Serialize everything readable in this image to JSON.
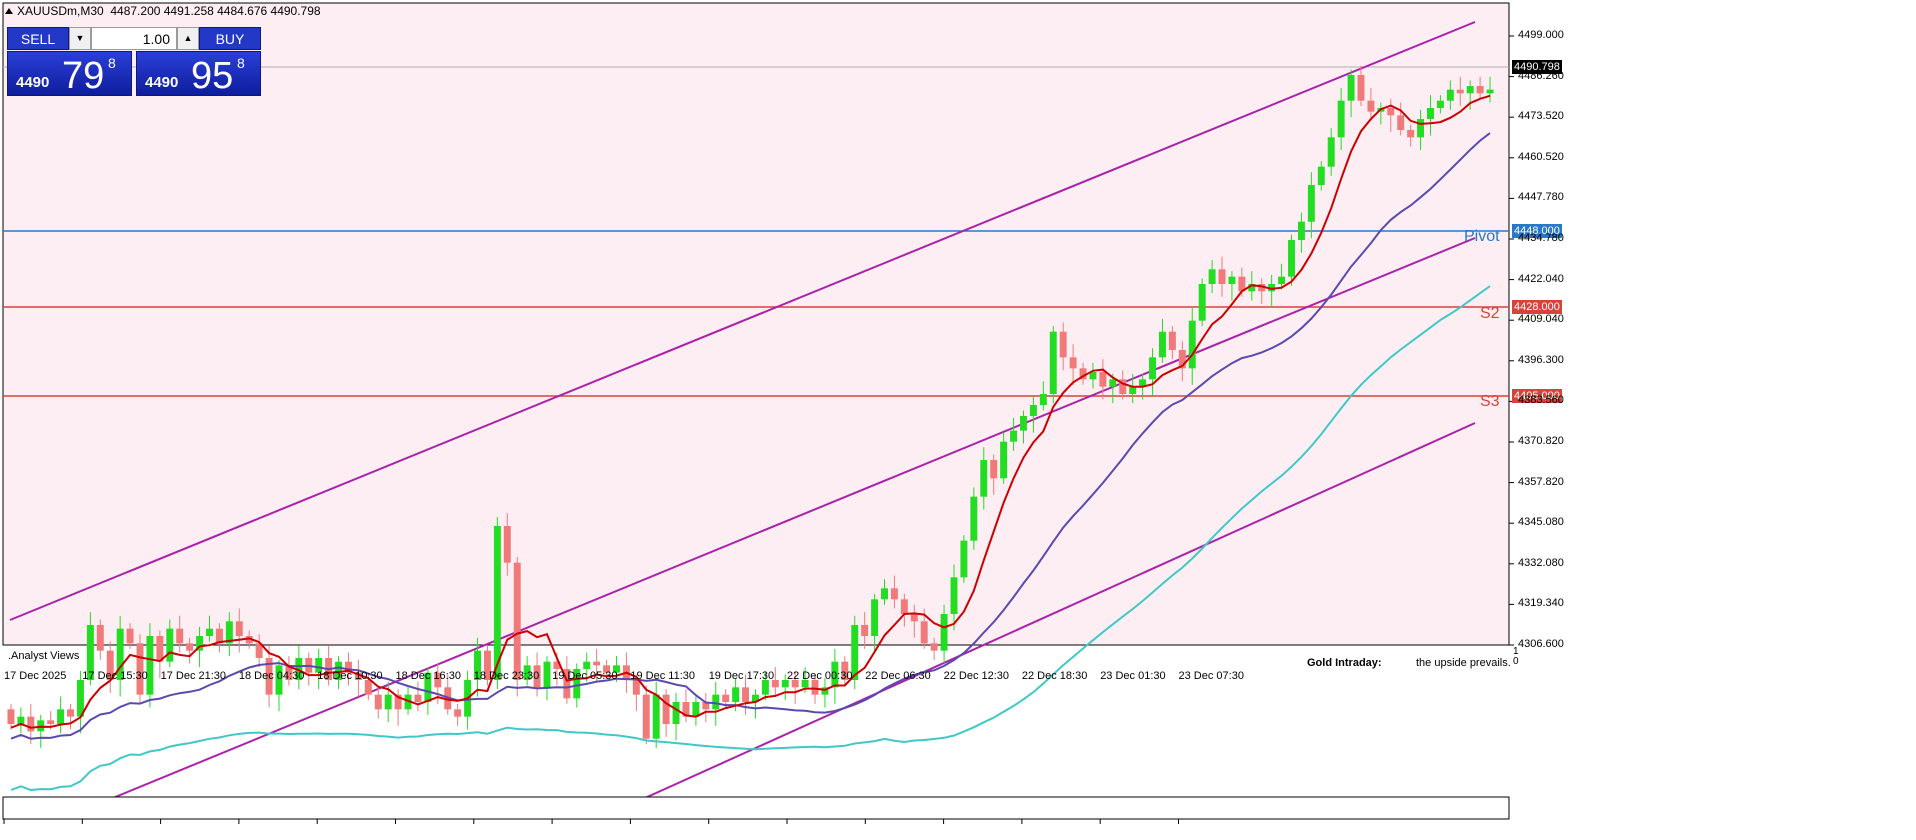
{
  "header": {
    "symbol_timeframe": "XAUUSDm,M30",
    "ohlc": "4487.200 4491.258 4484.676 4490.798"
  },
  "trading_panel": {
    "sell_label": "SELL",
    "buy_label": "BUY",
    "lot": "1.00",
    "sell_price_small": "4490",
    "sell_price_big": "79",
    "sell_price_sup": "8",
    "buy_price_small": "4490",
    "buy_price_big": "95",
    "buy_price_sup": "8"
  },
  "levels": {
    "pivot_label": "Pivot",
    "pivot_value": "4448.000",
    "s2_label": "S2",
    "s2_value": "4428.000",
    "s3_label": "S3",
    "s3_value": "4405.000",
    "current_price": "4490.798"
  },
  "colors": {
    "background": "#fdeef4",
    "bull": "#22dd22",
    "bear": "#f07a7a",
    "ma_fast": "#cc0000",
    "ma_mid": "#5a4ab0",
    "ma_slow": "#40c8c8",
    "channel": "#aa22aa",
    "pivot": "#2a78c8",
    "support": "#d8423a"
  },
  "price_axis": [
    "4499.000",
    "4486.260",
    "4473.520",
    "4460.520",
    "4447.780",
    "4434.780",
    "4422.040",
    "4409.040",
    "4396.300",
    "4383.560",
    "4370.820",
    "4357.820",
    "4345.080",
    "4332.080",
    "4319.340",
    "4306.600"
  ],
  "time_axis": [
    "17 Dec 2025",
    "17 Dec 15:30",
    "17 Dec 21:30",
    "18 Dec 04:30",
    "18 Dec 10:30",
    "18 Dec 16:30",
    "18 Dec 23:30",
    "19 Dec 05:30",
    "19 Dec 11:30",
    "19 Dec 17:30",
    "22 Dec 00:30",
    "22 Dec 06:30",
    "22 Dec 12:30",
    "22 Dec 18:30",
    "23 Dec 01:30",
    "23 Dec 07:30"
  ],
  "sub_pane": {
    "label": ".Analyst Views",
    "text_title": "Gold Intraday:",
    "text_body": "the upside prevails.",
    "scale_top": "1",
    "scale_bottom": "0"
  },
  "chart_data": {
    "type": "candlestick",
    "ylim": [
      4300,
      4510
    ],
    "candle_count": 150,
    "open_close": [
      [
        4322,
        4318
      ],
      [
        4318,
        4320
      ],
      [
        4320,
        4316
      ],
      [
        4316,
        4319
      ],
      [
        4319,
        4318
      ],
      [
        4318,
        4322
      ],
      [
        4322,
        4320
      ],
      [
        4320,
        4330
      ],
      [
        4330,
        4345
      ],
      [
        4345,
        4338
      ],
      [
        4338,
        4330
      ],
      [
        4330,
        4344
      ],
      [
        4344,
        4340
      ],
      [
        4340,
        4326
      ],
      [
        4326,
        4342
      ],
      [
        4342,
        4335
      ],
      [
        4335,
        4344
      ],
      [
        4344,
        4340
      ],
      [
        4340,
        4338
      ],
      [
        4338,
        4342
      ],
      [
        4342,
        4344
      ],
      [
        4344,
        4340
      ],
      [
        4340,
        4346
      ],
      [
        4346,
        4342
      ],
      [
        4342,
        4340
      ],
      [
        4340,
        4336
      ],
      [
        4336,
        4326
      ],
      [
        4326,
        4334
      ],
      [
        4334,
        4330
      ],
      [
        4330,
        4336
      ],
      [
        4336,
        4332
      ],
      [
        4332,
        4336
      ],
      [
        4336,
        4330
      ],
      [
        4330,
        4335
      ],
      [
        4335,
        4332
      ],
      [
        4332,
        4330
      ],
      [
        4330,
        4326
      ],
      [
        4326,
        4322
      ],
      [
        4322,
        4326
      ],
      [
        4326,
        4322
      ],
      [
        4322,
        4326
      ],
      [
        4326,
        4324
      ],
      [
        4324,
        4332
      ],
      [
        4332,
        4328
      ],
      [
        4328,
        4322
      ],
      [
        4322,
        4320
      ],
      [
        4320,
        4330
      ],
      [
        4330,
        4338
      ],
      [
        4338,
        4330
      ],
      [
        4330,
        4372
      ],
      [
        4372,
        4362
      ],
      [
        4362,
        4330
      ],
      [
        4330,
        4334
      ],
      [
        4334,
        4328
      ],
      [
        4328,
        4335
      ],
      [
        4335,
        4333
      ],
      [
        4333,
        4325
      ],
      [
        4325,
        4333
      ],
      [
        4333,
        4335
      ],
      [
        4335,
        4334
      ],
      [
        4334,
        4332
      ],
      [
        4332,
        4334
      ],
      [
        4334,
        4330
      ],
      [
        4330,
        4326
      ],
      [
        4326,
        4314
      ],
      [
        4314,
        4326
      ],
      [
        4326,
        4318
      ],
      [
        4318,
        4324
      ],
      [
        4324,
        4320
      ],
      [
        4320,
        4324
      ],
      [
        4324,
        4322
      ],
      [
        4322,
        4326
      ],
      [
        4326,
        4324
      ],
      [
        4324,
        4328
      ],
      [
        4328,
        4324
      ],
      [
        4324,
        4326
      ],
      [
        4326,
        4330
      ],
      [
        4330,
        4328
      ],
      [
        4328,
        4330
      ],
      [
        4330,
        4328
      ],
      [
        4328,
        4330
      ],
      [
        4330,
        4326
      ],
      [
        4326,
        4328
      ],
      [
        4328,
        4335
      ],
      [
        4335,
        4330
      ],
      [
        4330,
        4345
      ],
      [
        4345,
        4342
      ],
      [
        4342,
        4352
      ],
      [
        4352,
        4355
      ],
      [
        4355,
        4352
      ],
      [
        4352,
        4348
      ],
      [
        4348,
        4346
      ],
      [
        4346,
        4340
      ],
      [
        4340,
        4338
      ],
      [
        4338,
        4348
      ],
      [
        4348,
        4358
      ],
      [
        4358,
        4368
      ],
      [
        4368,
        4380
      ],
      [
        4380,
        4390
      ],
      [
        4390,
        4385
      ],
      [
        4385,
        4395
      ],
      [
        4395,
        4398
      ],
      [
        4398,
        4402
      ],
      [
        4402,
        4405
      ],
      [
        4405,
        4408
      ],
      [
        4408,
        4425
      ],
      [
        4425,
        4418
      ],
      [
        4418,
        4415
      ],
      [
        4415,
        4412
      ],
      [
        4412,
        4414
      ],
      [
        4414,
        4410
      ],
      [
        4410,
        4412
      ],
      [
        4412,
        4408
      ],
      [
        4408,
        4410
      ],
      [
        4410,
        4412
      ],
      [
        4412,
        4418
      ],
      [
        4418,
        4425
      ],
      [
        4425,
        4420
      ],
      [
        4420,
        4415
      ],
      [
        4415,
        4428
      ],
      [
        4428,
        4438
      ],
      [
        4438,
        4442
      ],
      [
        4442,
        4438
      ],
      [
        4438,
        4440
      ],
      [
        4440,
        4436
      ],
      [
        4436,
        4438
      ],
      [
        4438,
        4436
      ],
      [
        4436,
        4438
      ],
      [
        4438,
        4440
      ],
      [
        4440,
        4450
      ],
      [
        4450,
        4455
      ],
      [
        4455,
        4465
      ],
      [
        4465,
        4470
      ],
      [
        4470,
        4478
      ],
      [
        4478,
        4488
      ],
      [
        4488,
        4495
      ],
      [
        4495,
        4488
      ],
      [
        4488,
        4485
      ],
      [
        4485,
        4486
      ],
      [
        4486,
        4484
      ],
      [
        4484,
        4480
      ],
      [
        4480,
        4478
      ],
      [
        4478,
        4483
      ],
      [
        4483,
        4486
      ],
      [
        4486,
        4488
      ],
      [
        4488,
        4491
      ],
      [
        4491,
        4490
      ],
      [
        4490,
        4492
      ],
      [
        4492,
        4490
      ],
      [
        4490,
        4491
      ]
    ]
  }
}
